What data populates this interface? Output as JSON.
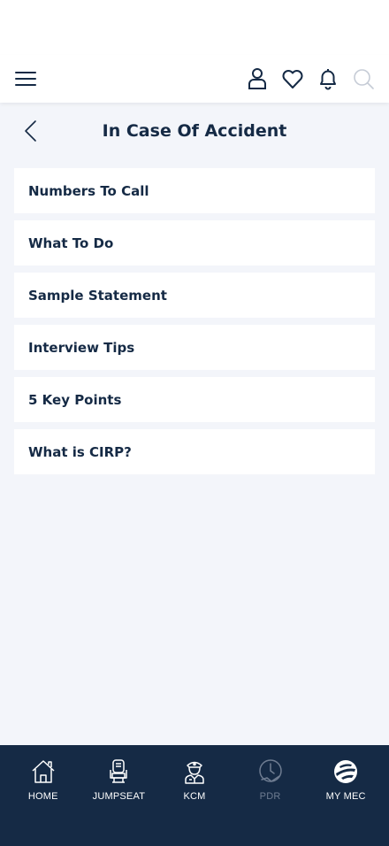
{
  "header": {
    "icons": [
      "menu-icon",
      "user-icon",
      "heart-icon",
      "bell-icon",
      "search-icon"
    ]
  },
  "page": {
    "title": "In Case Of Accident"
  },
  "list": {
    "items": [
      {
        "label": "Numbers To Call"
      },
      {
        "label": "What To Do"
      },
      {
        "label": "Sample Statement"
      },
      {
        "label": "Interview Tips"
      },
      {
        "label": "5 Key Points"
      },
      {
        "label": "What is CIRP?"
      }
    ]
  },
  "tabbar": {
    "items": [
      {
        "label": "HOME",
        "icon": "home-icon",
        "enabled": true
      },
      {
        "label": "JUMPSEAT",
        "icon": "seat-icon",
        "enabled": true
      },
      {
        "label": "KCM",
        "icon": "pilot-icon",
        "enabled": true
      },
      {
        "label": "PDR",
        "icon": "pdr-icon",
        "enabled": false
      },
      {
        "label": "MY MEC",
        "icon": "globe-icon",
        "enabled": true
      }
    ]
  },
  "colors": {
    "navy": "#152a45",
    "background": "#f3f5fa",
    "disabled": "#6e7c91"
  }
}
